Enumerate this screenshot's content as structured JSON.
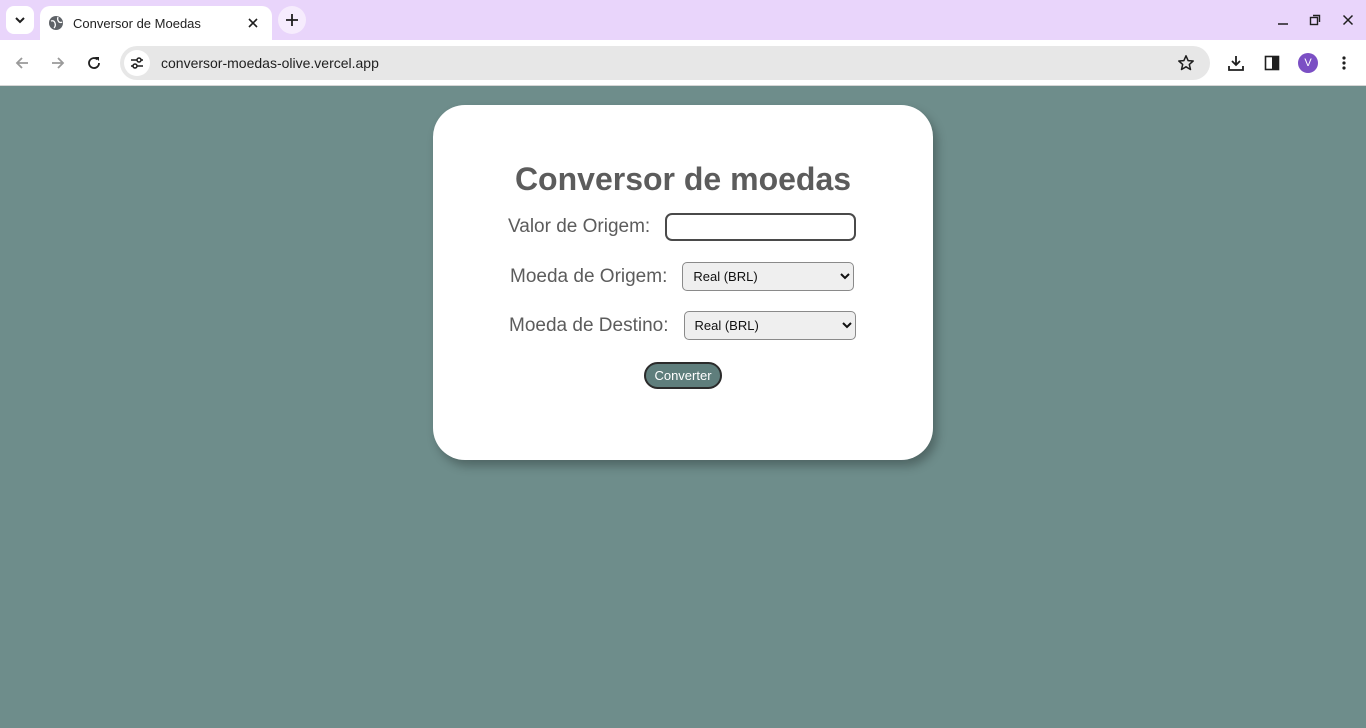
{
  "browser": {
    "tab": {
      "title": "Conversor de Moedas"
    },
    "address_bar": {
      "url": "conversor-moedas-olive.vercel.app"
    },
    "profile": {
      "initial": "V"
    },
    "colors": {
      "tabstrip": "#e9d5fb",
      "profile": "#7b4fc4"
    },
    "icons": [
      "tab-search-icon",
      "globe-icon",
      "close-icon",
      "plus-icon",
      "minimize-icon",
      "restore-icon",
      "window-close-icon",
      "back-arrow-icon",
      "forward-arrow-icon",
      "reload-icon",
      "site-settings-icon",
      "star-icon",
      "download-icon",
      "side-panel-icon",
      "more-vert-icon"
    ]
  },
  "page": {
    "background": "#6e8d8b",
    "title": "Conversor de moedas",
    "form": {
      "value_label": "Valor de Origem:",
      "value_input": "",
      "source_label": "Moeda de Origem:",
      "source_selected": "Real (BRL)",
      "target_label": "Moeda de Destino:",
      "target_selected": "Real (BRL)",
      "convert_label": "Converter"
    },
    "colors": {
      "button": "#5f7e7c",
      "text": "#5c5c5c"
    }
  }
}
